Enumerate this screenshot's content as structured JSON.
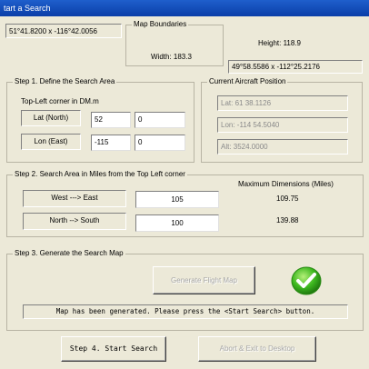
{
  "window": {
    "title": "tart a Search"
  },
  "top": {
    "top_left_coords": "51°41.8200 x -116°42.0056",
    "map_boundaries_title": "Map Boundaries",
    "width_label": "Width: 183.3",
    "height_label": "Height: 118.9",
    "bottom_right_coords": "49°58.5586 x -112°25.2176"
  },
  "step1": {
    "title": "Step 1. Define the Search Area",
    "subtitle": "Top-Left corner in DM.m",
    "lat_label": "Lat (North)",
    "lat_deg": "52",
    "lat_min": "0",
    "lon_label": "Lon (East)",
    "lon_deg": "-115",
    "lon_min": "0"
  },
  "aircraft": {
    "title": "Current Aircraft Position",
    "lat": "Lat: 61  38.1126",
    "lon": "Lon: -114  54.5040",
    "alt": "Alt: 3524.0000"
  },
  "step2": {
    "title": "Step 2. Search Area in Miles from the Top Left corner",
    "max_title": "Maximum Dimensions (Miles)",
    "west_east_label": "West ---> East",
    "west_east_value": "105",
    "west_east_max": "109.75",
    "north_south_label": "North --> South",
    "north_south_value": "100",
    "north_south_max": "139.88"
  },
  "step3": {
    "title": "Step 3. Generate the Search Map",
    "generate_label": "Generate Flight Map",
    "status_message": "Map has been generated. Please press the <Start Search> button."
  },
  "footer": {
    "start_label": "Step 4. Start Search",
    "abort_label": "Abort & Exit to Desktop"
  },
  "colors": {
    "check_green": "#3db81f",
    "title_blue": "#0a3ea8"
  }
}
